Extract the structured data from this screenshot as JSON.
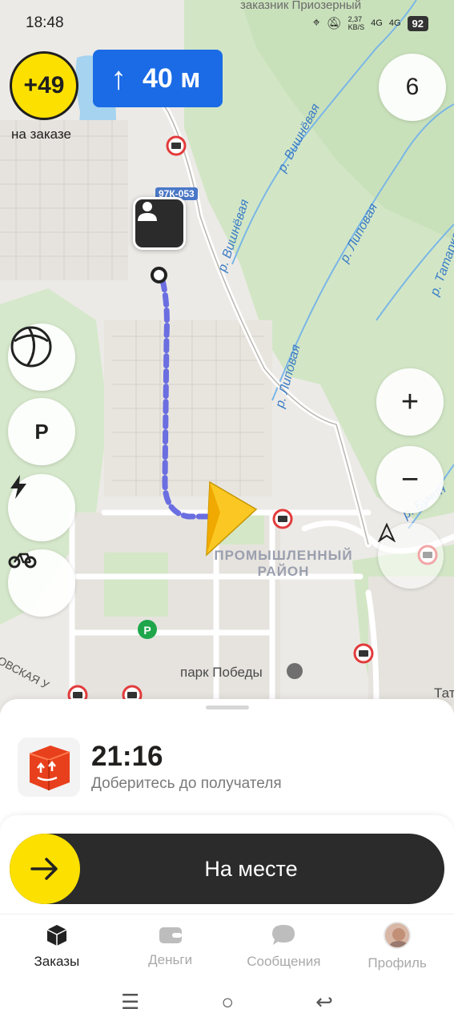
{
  "status_bar": {
    "time": "18:48",
    "net_speed": "2,37",
    "net_unit": "KB/S",
    "sig1": "4G",
    "sig2": "4G",
    "battery": "92"
  },
  "map": {
    "bonus_value": "+49",
    "bonus_label": "на заказе",
    "nav_distance": "40 м",
    "nav_arrow": "arrow-up-icon",
    "orders_count": "6",
    "road_tag": "97К-053",
    "labels": {
      "reserve": "заказник Приозерный",
      "river1": "р. Вишнёвая",
      "river2": "р. Вишнёвая",
      "river3": "р. Липовая",
      "river4": "р. Липовая",
      "river5": "р. Татарка",
      "river6": "р. Бучин",
      "district_line1": "ПРОМЫШЛЕННЫЙ",
      "district_line2": "РАЙОН",
      "park": "парк Победы",
      "street": "ОВСКАЯ У",
      "edge": "Тат"
    },
    "side_buttons": [
      "layers-icon",
      "parking-icon",
      "charging-icon",
      "bike-icon"
    ],
    "zoom_in": "+",
    "zoom_out": "−"
  },
  "order": {
    "eta": "21:16",
    "subtitle": "Доберитесь до получателя",
    "slider_label": "На месте"
  },
  "tabs": [
    {
      "label": "Заказы",
      "icon": "box-icon",
      "active": true
    },
    {
      "label": "Деньги",
      "icon": "wallet-icon",
      "active": false
    },
    {
      "label": "Сообщения",
      "icon": "chat-icon",
      "active": false
    },
    {
      "label": "Профиль",
      "icon": "avatar",
      "active": false
    }
  ],
  "colors": {
    "accent": "#fce000",
    "nav_blue": "#1a6be5",
    "route": "#6a6ee0",
    "dark": "#2b2b2b"
  }
}
